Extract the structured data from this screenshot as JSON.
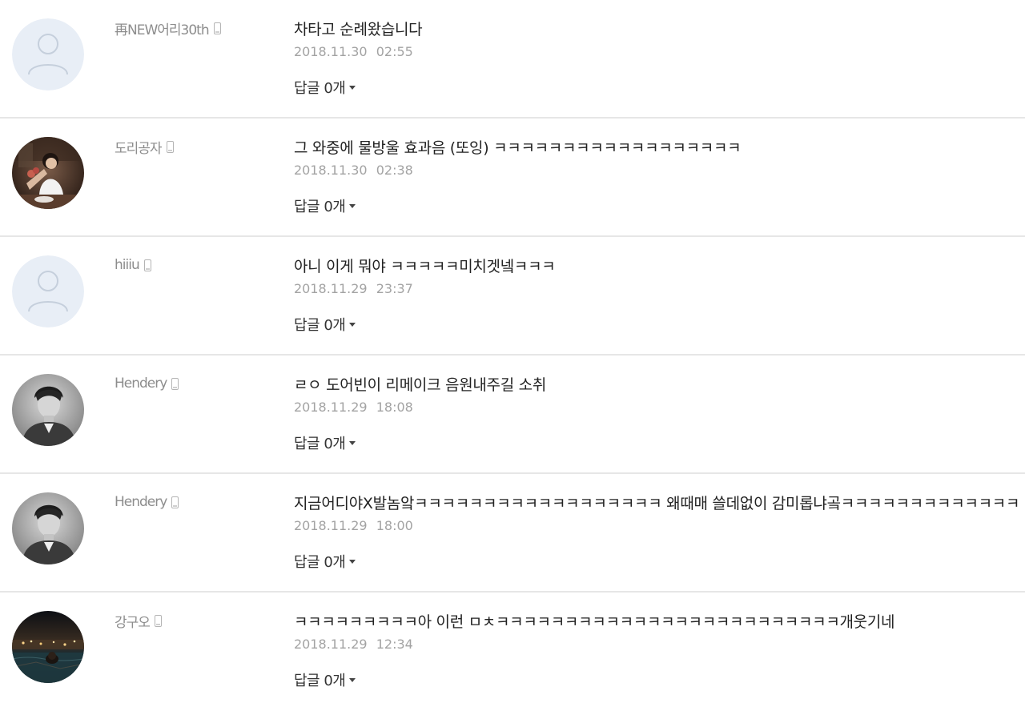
{
  "comments": [
    {
      "author": "再NEW어리30th",
      "avatar": "default-avatar",
      "text": "차타고 순례왔습니다",
      "date": "2018.11.30",
      "time": "02:55",
      "reply_label": "답글 0개"
    },
    {
      "author": "도리공자",
      "avatar": "photo-avatar-woman-flowers",
      "text": "그 와중에 물방울 효과음 (또잉) ㅋㅋㅋㅋㅋㅋㅋㅋㅋㅋㅋㅋㅋㅋㅋㅋㅋㅋ",
      "date": "2018.11.30",
      "time": "02:38",
      "reply_label": "답글 0개"
    },
    {
      "author": "hiiiu",
      "avatar": "default-avatar",
      "text": "아니 이게 뭐야 ㅋㅋㅋㅋㅋ미치겟넼ㅋㅋㅋ",
      "date": "2018.11.29",
      "time": "23:37",
      "reply_label": "답글 0개"
    },
    {
      "author": "Hendery",
      "avatar": "photo-avatar-man-bw",
      "text": "ㄹㅇ 도어빈이 리메이크 음원내주길 소취",
      "date": "2018.11.29",
      "time": "18:08",
      "reply_label": "답글 0개"
    },
    {
      "author": "Hendery",
      "avatar": "photo-avatar-man-bw",
      "text": "지금어디야X발놈앜ㅋㅋㅋㅋㅋㅋㅋㅋㅋㅋㅋㅋㅋㅋㅋㅋㅋㅋ 왜때매 쓸데없이 감미롭냐곸ㅋㅋㅋㅋㅋㅋㅋㅋㅋㅋㅋㅋㅋ",
      "date": "2018.11.29",
      "time": "18:00",
      "reply_label": "답글 0개"
    },
    {
      "author": "강구오",
      "avatar": "photo-avatar-night-pool",
      "text": "ㅋㅋㅋㅋㅋㅋㅋㅋㅋ아 이런 ㅁㅊㅋㅋㅋㅋㅋㅋㅋㅋㅋㅋㅋㅋㅋㅋㅋㅋㅋㅋㅋㅋㅋㅋㅋㅋㅋ개웃기네",
      "date": "2018.11.29",
      "time": "12:34",
      "reply_label": "답글 0개"
    }
  ],
  "icons": {
    "device": "mobile-phone-icon",
    "reply_toggle": "caret-down-icon"
  },
  "colors": {
    "author": "#8d8d8d",
    "text": "#222222",
    "date": "#a3a3a3",
    "divider": "#e6e6e6",
    "default_avatar_bg": "#e8eef6",
    "default_avatar_line": "#c5cfdc"
  }
}
